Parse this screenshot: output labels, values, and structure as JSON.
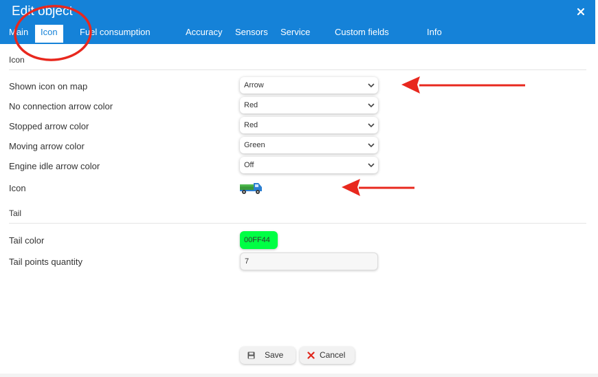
{
  "dialog": {
    "title": "Edit object"
  },
  "tabs": [
    {
      "label": "Main"
    },
    {
      "label": "Icon"
    },
    {
      "label": "Fuel consumption"
    },
    {
      "label": "Accuracy"
    },
    {
      "label": "Sensors"
    },
    {
      "label": "Service"
    },
    {
      "label": "Custom fields"
    },
    {
      "label": "Info"
    }
  ],
  "icon_section": {
    "title": "Icon",
    "rows": [
      {
        "label": "Shown icon on map",
        "value": "Arrow"
      },
      {
        "label": "No connection arrow color",
        "value": "Red"
      },
      {
        "label": "Stopped arrow color",
        "value": "Red"
      },
      {
        "label": "Moving arrow color",
        "value": "Green"
      },
      {
        "label": "Engine idle arrow color",
        "value": "Off"
      }
    ],
    "icon_label": "Icon",
    "icon_image": "truck-icon"
  },
  "tail_section": {
    "title": "Tail",
    "color_label": "Tail color",
    "color_value": "00FF44",
    "color_hex": "#00FF44",
    "points_label": "Tail points quantity",
    "points_value": "7"
  },
  "footer": {
    "save_label": "Save",
    "cancel_label": "Cancel"
  },
  "colors": {
    "header": "#1582D8",
    "annotation": "#E8281E"
  }
}
